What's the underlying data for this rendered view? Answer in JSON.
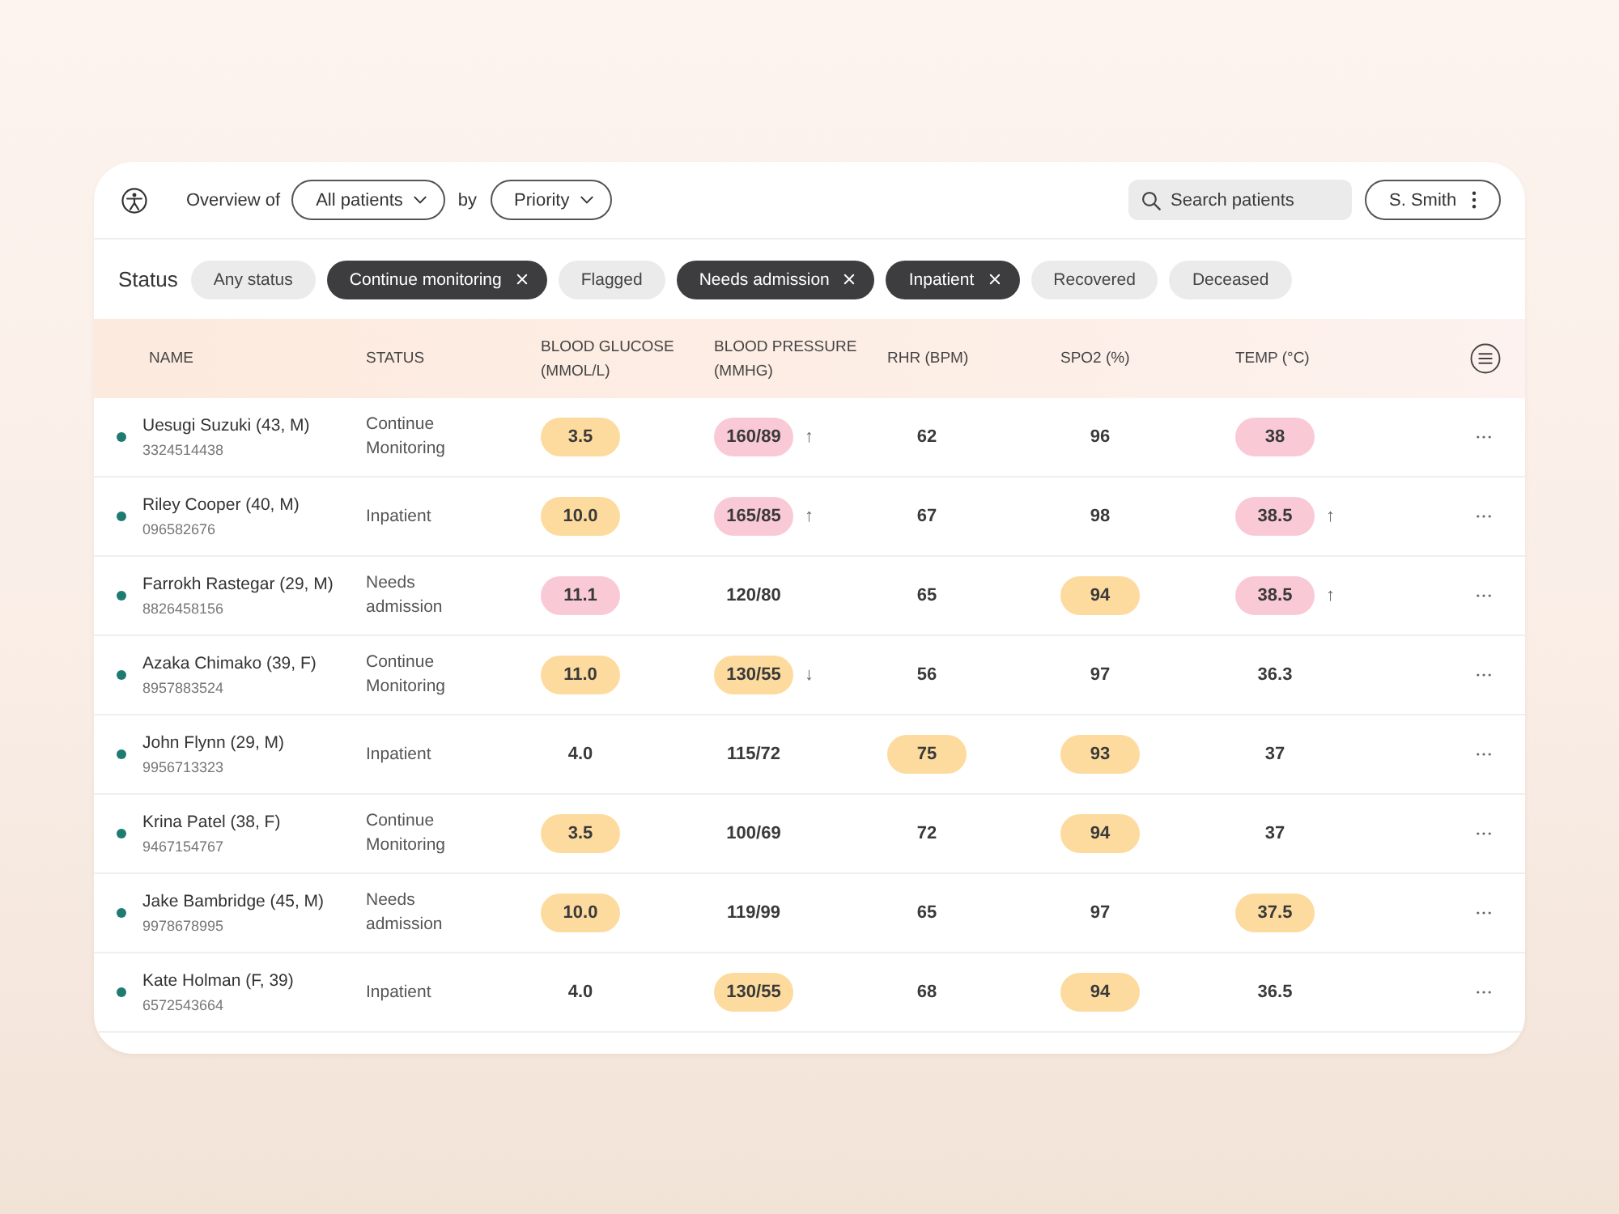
{
  "top_bar": {
    "overview_label": "Overview of",
    "patients_dropdown": "All patients",
    "by_label": "by",
    "sort_dropdown": "Priority",
    "search": {
      "placeholder": "Search patients"
    },
    "user_button": "S. Smith"
  },
  "status_filter": {
    "label": "Status",
    "chips": [
      {
        "label": "Any status",
        "selected": false
      },
      {
        "label": "Continue monitoring",
        "selected": true
      },
      {
        "label": "Flagged",
        "selected": false
      },
      {
        "label": "Needs admission",
        "selected": true
      },
      {
        "label": "Inpatient",
        "selected": true
      },
      {
        "label": "Recovered",
        "selected": false
      },
      {
        "label": "Deceased",
        "selected": false
      }
    ]
  },
  "table": {
    "columns": [
      "NAME",
      "STATUS",
      "BLOOD GLUCOSE (MMOL/L)",
      "BLOOD PRESSURE (MMHG)",
      "RHR (BPM)",
      "SPO2 (%)",
      "TEMP (°C)"
    ],
    "rows": [
      {
        "name": "Uesugi Suzuki (43, M)",
        "patient_id": "3324514438",
        "status": "Continue Monitoring",
        "vitals": [
          {
            "value": "3.5",
            "color": "#fddb9e"
          },
          {
            "value": "160/89",
            "color": "#f9cad5",
            "trend": "↑"
          },
          {
            "value": "62"
          },
          {
            "value": "96"
          },
          {
            "value": "38",
            "color": "#f9cad5"
          }
        ]
      },
      {
        "name": "Riley Cooper (40, M)",
        "patient_id": "096582676",
        "status": "Inpatient",
        "vitals": [
          {
            "value": "10.0",
            "color": "#fddb9e"
          },
          {
            "value": "165/85",
            "color": "#f9cad5",
            "trend": "↑"
          },
          {
            "value": "67"
          },
          {
            "value": "98"
          },
          {
            "value": "38.5",
            "color": "#f9cad5",
            "trend": "↑"
          }
        ]
      },
      {
        "name": "Farrokh Rastegar (29, M)",
        "patient_id": "8826458156",
        "status": "Needs admission",
        "vitals": [
          {
            "value": "11.1",
            "color": "#f9cad5"
          },
          {
            "value": "120/80"
          },
          {
            "value": "65"
          },
          {
            "value": "94",
            "color": "#fddb9e"
          },
          {
            "value": "38.5",
            "color": "#f9cad5",
            "trend": "↑"
          }
        ]
      },
      {
        "name": "Azaka Chimako (39, F)",
        "patient_id": "8957883524",
        "status": "Continue Monitoring",
        "vitals": [
          {
            "value": "11.0",
            "color": "#fddb9e"
          },
          {
            "value": "130/55",
            "color": "#fddb9e",
            "trend": "↓"
          },
          {
            "value": "56"
          },
          {
            "value": "97"
          },
          {
            "value": "36.3"
          }
        ]
      },
      {
        "name": "John Flynn (29, M)",
        "patient_id": "9956713323",
        "status": "Inpatient",
        "vitals": [
          {
            "value": "4.0"
          },
          {
            "value": "115/72"
          },
          {
            "value": "75",
            "color": "#fddb9e"
          },
          {
            "value": "93",
            "color": "#fddb9e"
          },
          {
            "value": "37"
          }
        ]
      },
      {
        "name": "Krina Patel (38, F)",
        "patient_id": "9467154767",
        "status": "Continue Monitoring",
        "vitals": [
          {
            "value": "3.5",
            "color": "#fddb9e"
          },
          {
            "value": "100/69"
          },
          {
            "value": "72"
          },
          {
            "value": "94",
            "color": "#fddb9e"
          },
          {
            "value": "37"
          }
        ]
      },
      {
        "name": "Jake Bambridge (45, M)",
        "patient_id": "9978678995",
        "status": "Needs admission",
        "vitals": [
          {
            "value": "10.0",
            "color": "#fddb9e"
          },
          {
            "value": "119/99"
          },
          {
            "value": "65"
          },
          {
            "value": "97"
          },
          {
            "value": "37.5",
            "color": "#fddb9e"
          }
        ]
      },
      {
        "name": "Kate Holman (F, 39)",
        "patient_id": "6572543664",
        "status": "Inpatient",
        "vitals": [
          {
            "value": "4.0"
          },
          {
            "value": "130/55",
            "color": "#fddb9e"
          },
          {
            "value": "68"
          },
          {
            "value": "94",
            "color": "#fddb9e"
          },
          {
            "value": "36.5"
          }
        ]
      }
    ]
  }
}
